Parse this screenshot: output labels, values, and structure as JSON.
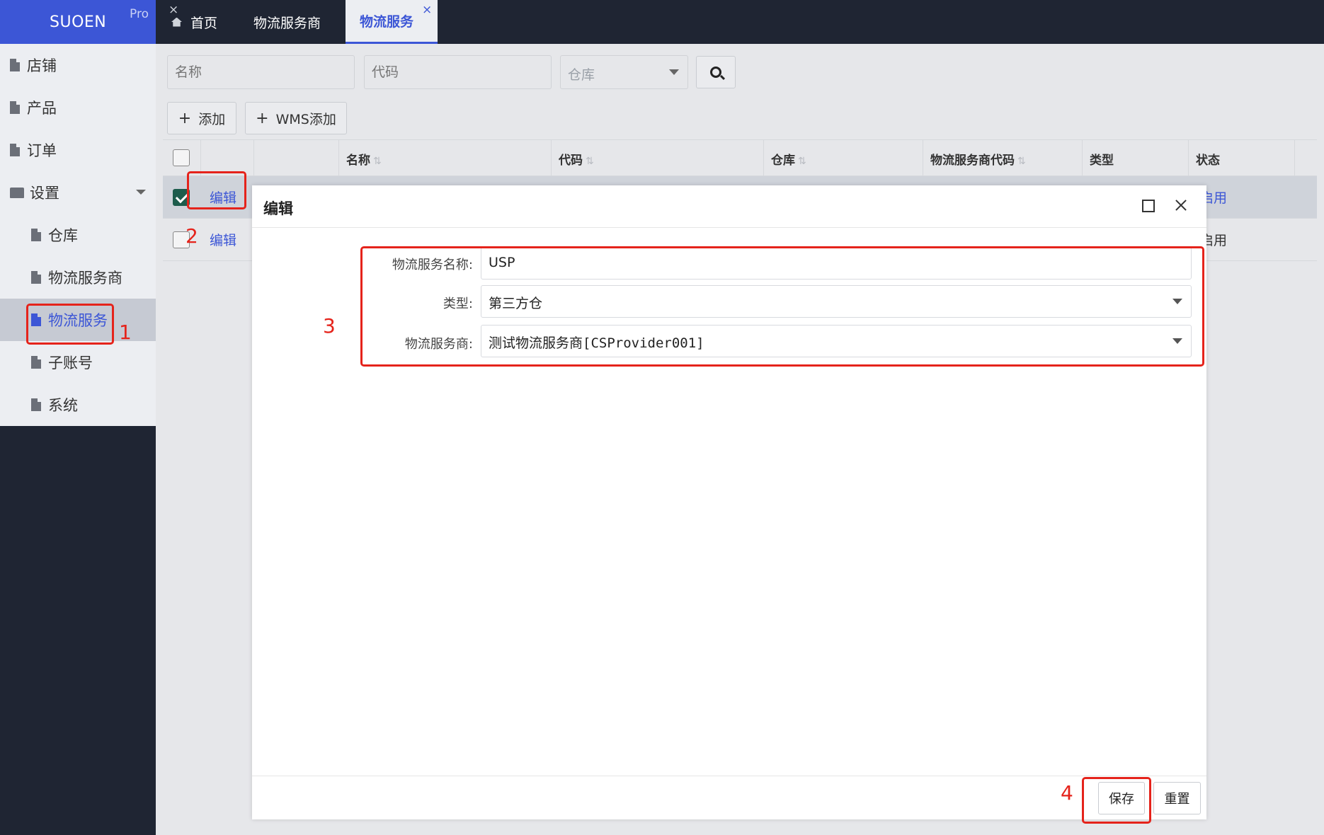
{
  "brand": {
    "name": "SUOEN",
    "badge": "Pro"
  },
  "sidebar": {
    "items": [
      {
        "label": "店铺"
      },
      {
        "label": "产品"
      },
      {
        "label": "订单"
      },
      {
        "label": "设置"
      },
      {
        "label": "仓库"
      },
      {
        "label": "物流服务商"
      },
      {
        "label": "物流服务"
      },
      {
        "label": "子账号"
      },
      {
        "label": "系统"
      }
    ]
  },
  "tabs": [
    {
      "label": "首页"
    },
    {
      "label": "物流服务商",
      "close": "×"
    },
    {
      "label": "物流服务",
      "close": "×"
    }
  ],
  "filters": {
    "name_placeholder": "名称",
    "code_placeholder": "代码",
    "warehouse_placeholder": "仓库"
  },
  "toolbar": {
    "add_label": "添加",
    "wms_add_label": "WMS添加",
    "plus": "+"
  },
  "table": {
    "headers": [
      "名称",
      "代码",
      "仓库",
      "物流服务商代码",
      "类型",
      "状态"
    ],
    "sort_glyph": "⇅",
    "rows": [
      {
        "action": "编辑",
        "status": "启用"
      },
      {
        "action": "编辑",
        "status": "启用"
      }
    ]
  },
  "modal": {
    "title": "编辑",
    "fields": [
      {
        "label": "物流服务名称:",
        "value": "USP"
      },
      {
        "label": "类型:",
        "value": "第三方仓"
      },
      {
        "label": "物流服务商:",
        "value": "测试物流服务商[CSProvider001]"
      }
    ],
    "save_label": "保存",
    "reset_label": "重置"
  },
  "annotations": [
    "1",
    "2",
    "3",
    "4"
  ],
  "colors": {
    "accent": "#3c56d6",
    "dark": "#1f2533",
    "annotation": "#e5231b"
  }
}
